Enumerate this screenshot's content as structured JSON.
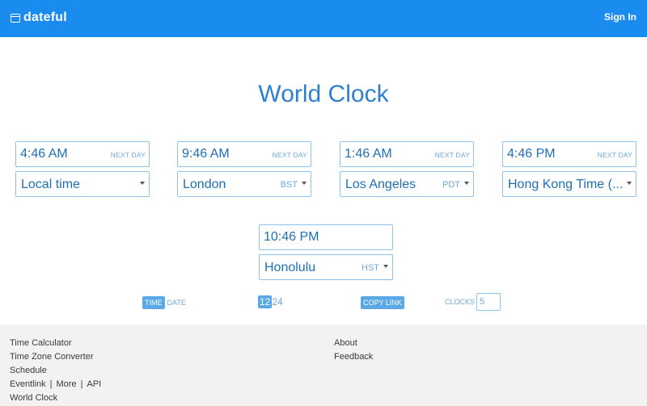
{
  "header": {
    "app_name": "dateful",
    "logo_icon": "calendar-window-icon",
    "sign_in_label": "Sign In",
    "bar_color": "#1a8cf0"
  },
  "main": {
    "title": "World Clock"
  },
  "clocks": [
    {
      "time": "4:46 AM",
      "day_label": "NEXT DAY",
      "zone": "Local time",
      "abbr": ""
    },
    {
      "time": "9:46 AM",
      "day_label": "NEXT DAY",
      "zone": "London",
      "abbr": "BST"
    },
    {
      "time": "1:46 AM",
      "day_label": "NEXT DAY",
      "zone": "Los Angeles",
      "abbr": "PDT"
    },
    {
      "time": "4:46 PM",
      "day_label": "NEXT DAY",
      "zone": "Hong Kong Time (...",
      "abbr": ""
    },
    {
      "time": "10:46 PM",
      "day_label": "",
      "zone": "Honolulu",
      "abbr": "HST"
    }
  ],
  "controls": {
    "time_label": "TIME",
    "date_label": "DATE",
    "format_12": "12",
    "format_24": "24",
    "copy_link_label": "COPY LINK",
    "clocks_label": "CLOCKS",
    "clocks_value": "5"
  },
  "footer": {
    "left_links": {
      "time_calculator": "Time Calculator",
      "time_zone_converter": "Time Zone Converter",
      "schedule": "Schedule",
      "eventlink": "Eventlink",
      "more": "More",
      "api": "API",
      "world_clock": "World Clock",
      "separator": "|"
    },
    "right_links": {
      "about": "About",
      "feedback": "Feedback"
    }
  }
}
